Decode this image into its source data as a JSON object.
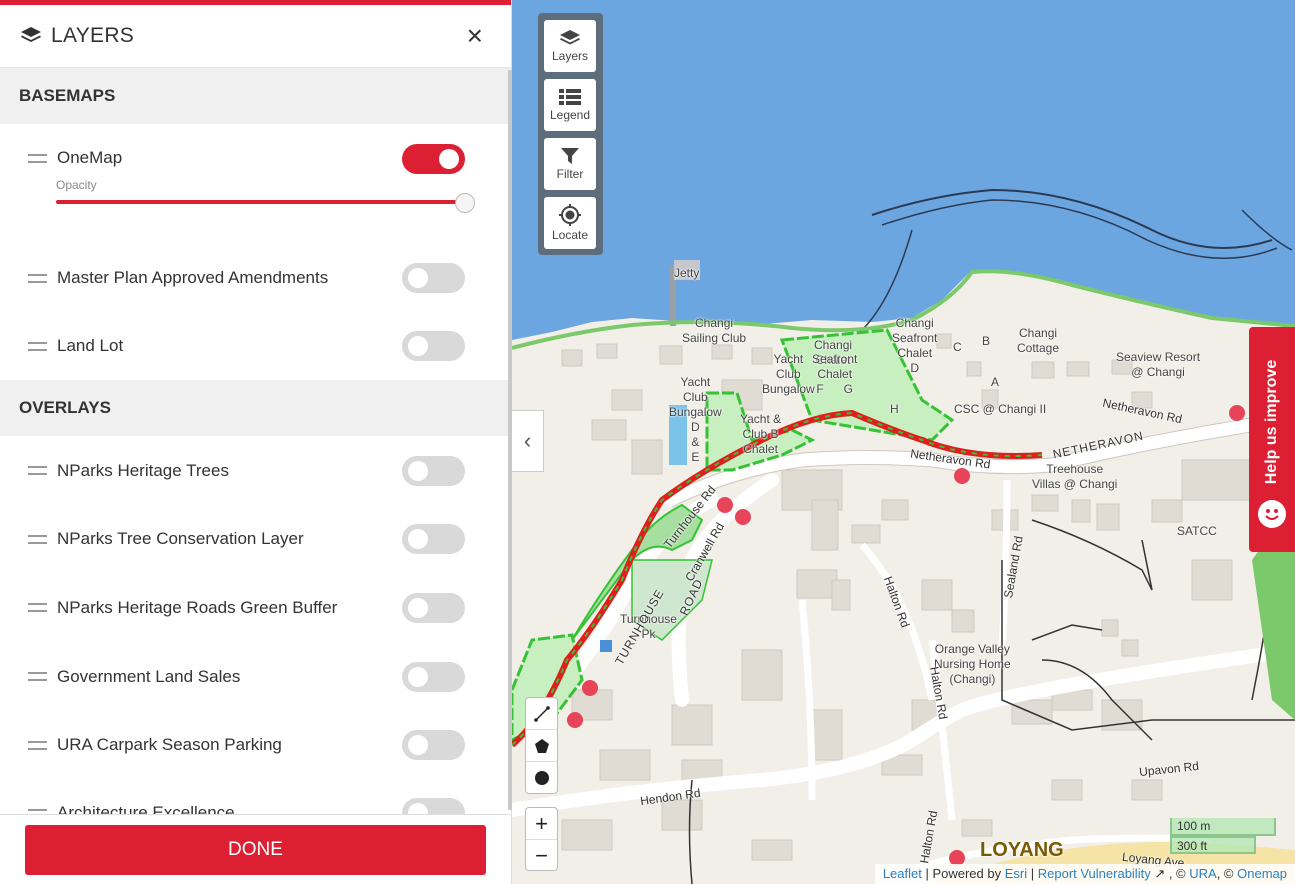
{
  "panel": {
    "title": "LAYERS",
    "close_symbol": "×",
    "basemaps_heading": "BASEMAPS",
    "overlays_heading": "OVERLAYS",
    "opacity_label": "Opacity",
    "opacity_value": 1.0,
    "done_label": "DONE",
    "basemaps": [
      {
        "label": "OneMap",
        "enabled": true
      },
      {
        "label": "Master Plan Approved Amendments",
        "enabled": false
      },
      {
        "label": "Land Lot",
        "enabled": false
      }
    ],
    "overlays": [
      {
        "label": "NParks Heritage Trees",
        "enabled": false
      },
      {
        "label": "NParks Tree Conservation Layer",
        "enabled": false
      },
      {
        "label": "NParks Heritage Roads Green Buffer",
        "enabled": false
      },
      {
        "label": "Government Land Sales",
        "enabled": false
      },
      {
        "label": "URA Carpark Season Parking",
        "enabled": false
      },
      {
        "label": "Architecture Excellence",
        "enabled": false
      }
    ]
  },
  "map_tools": {
    "layers": "Layers",
    "legend": "Legend",
    "filter": "Filter",
    "locate": "Locate",
    "collapse_symbol": "‹",
    "zoom_in": "+",
    "zoom_out": "−"
  },
  "help": {
    "label": "Help us improve"
  },
  "scale": {
    "metric": "100 m",
    "imperial": "300 ft"
  },
  "attribution": {
    "leaflet": "Leaflet",
    "sep1": " | Powered by ",
    "esri": "Esri",
    "sep2": " | ",
    "report": "Report Vulnerability",
    "sep3": " , © ",
    "ura": "URA",
    "sep4": ", © ",
    "onemap": "Onemap"
  },
  "map_labels": {
    "jetty": "Jetty",
    "sailing_club": "Changi\nSailing Club",
    "changi_chalet": "Changi\nChalet",
    "yacht_club_bungalow": "Yacht\nClub\nBungalow",
    "seafront_chalet": "Seafront\nChalet\nF      G",
    "changi_seafront_chalet_d": "Changi\nSeafront\nChalet\nD",
    "changi_cottage": "Changi\nCottage",
    "seaview": "Seaview Resort\n@ Changi",
    "yacht_club_bungalow_d": "Yacht\nClub\nBungalow\nD\n&\nE",
    "yacht_club_chalet": "Yacht &\nClub B\nChalet",
    "csc": "CSC @ Changi II",
    "treehouse": "Treehouse\nVillas @ Changi",
    "satcc": "SATCC",
    "turnhouse_pk": "Turnhouse\nPk",
    "orange_valley": "Orange Valley\nNursing Home\n(Changi)",
    "cluster_c": "C",
    "cluster_b": "B",
    "cluster_a": "A",
    "cluster_h": "H",
    "loyang_partial": "LOYANG"
  },
  "road_labels": {
    "netheravon_rd": "Netheravon Rd",
    "netheravon_caps": "NETHERAVON",
    "netheravon_rd2": "Netheravon Rd",
    "halton_rd": "Halton Rd",
    "halton_rd2": "Halton Rd",
    "seaaland_rd": "Sealand Rd",
    "upavon_rd": "Upavon Rd",
    "hendon_rd": "Hendon Rd",
    "turnhouse_rd": "Turnhouse Rd",
    "loyang_ave": "Loyang Ave",
    "cranwell_rd": "Cranwell Rd",
    "halton_rd3": "Halton Rd",
    "turnhouse_caps": "TURNHOUSE",
    "road_caps": "ROAD"
  },
  "colors": {
    "accent": "#dc1f33",
    "sea": "#6ca6e0",
    "land": "#f2efe9",
    "park": "#c8efc0",
    "park_outline": "#35c235",
    "route": "#e01e1e"
  }
}
